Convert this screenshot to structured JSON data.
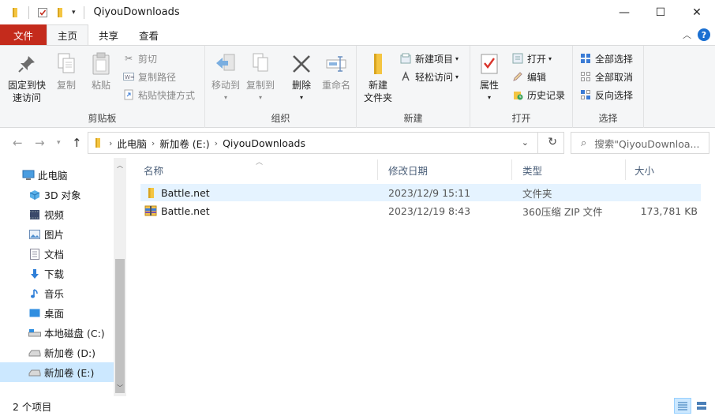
{
  "window": {
    "title": "QiyouDownloads",
    "minimize_glyph": "—",
    "maximize_glyph": "☐",
    "close_glyph": "✕"
  },
  "ribbon_tabs": [
    {
      "label": "文件"
    },
    {
      "label": "主页"
    },
    {
      "label": "共享"
    },
    {
      "label": "查看"
    }
  ],
  "clipboard": {
    "label": "剪贴板",
    "pin": "固定到快\n速访问",
    "copy": "复制",
    "paste": "粘贴",
    "cut": "剪切",
    "copy_path": "复制路径",
    "paste_shortcut": "粘贴快捷方式"
  },
  "organize": {
    "label": "组织",
    "move_to": "移动到",
    "copy_to": "复制到",
    "delete": "删除",
    "rename": "重命名"
  },
  "new": {
    "label": "新建",
    "new_folder": "新建\n文件夹",
    "new_item": "新建项目",
    "easy_access": "轻松访问"
  },
  "open": {
    "label": "打开",
    "properties": "属性",
    "open": "打开",
    "edit": "编辑",
    "history": "历史记录"
  },
  "select": {
    "label": "选择",
    "select_all": "全部选择",
    "select_none": "全部取消",
    "invert": "反向选择"
  },
  "address": {
    "crumbs": [
      "此电脑",
      "新加卷 (E:)",
      "QiyouDownloads"
    ],
    "search_placeholder": "搜索\"QiyouDownloa..."
  },
  "nav_items": [
    {
      "label": "此电脑",
      "icon": "computer-icon"
    },
    {
      "label": "3D 对象",
      "icon": "3d-objects-icon"
    },
    {
      "label": "视频",
      "icon": "video-icon"
    },
    {
      "label": "图片",
      "icon": "pictures-icon"
    },
    {
      "label": "文档",
      "icon": "documents-icon"
    },
    {
      "label": "下载",
      "icon": "download-icon"
    },
    {
      "label": "音乐",
      "icon": "music-icon"
    },
    {
      "label": "桌面",
      "icon": "desktop-icon"
    },
    {
      "label": "本地磁盘 (C:)",
      "icon": "drive-icon"
    },
    {
      "label": "新加卷 (D:)",
      "icon": "drive-icon"
    },
    {
      "label": "新加卷 (E:)",
      "icon": "drive-icon"
    }
  ],
  "columns": {
    "name": "名称",
    "modified": "修改日期",
    "type": "类型",
    "size": "大小"
  },
  "files": [
    {
      "name": "Battle.net",
      "modified": "2023/12/9 15:11",
      "type": "文件夹",
      "size": "",
      "icon": "folder-icon"
    },
    {
      "name": "Battle.net",
      "modified": "2023/12/19 8:43",
      "type": "360压缩 ZIP 文件",
      "size": "173,781 KB",
      "icon": "zip-archive-icon"
    }
  ],
  "status": {
    "item_count": "2 个项目"
  },
  "colors": {
    "file_tab": "#c42b1c",
    "selection": "#cce8ff",
    "hover": "#e5f3ff",
    "folder": "#f4c542",
    "help": "#1a6fd1"
  }
}
